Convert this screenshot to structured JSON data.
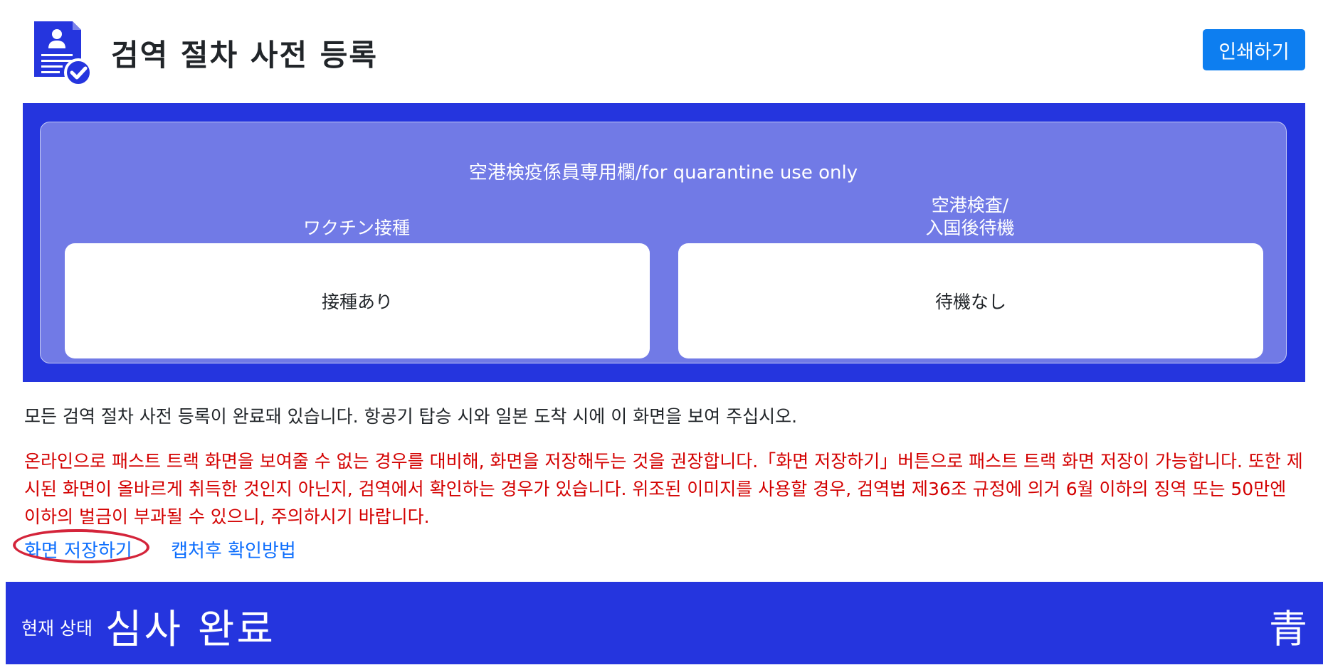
{
  "header": {
    "icon": "document-check-icon",
    "title": "검역 절차 사전 등록",
    "print_label": "인쇄하기",
    "accent_color": "#0d7ef0"
  },
  "quarantine": {
    "heading": "空港検疫係員専用欄/for quarantine use only",
    "columns": [
      {
        "label": "ワクチン接種",
        "value": "接種あり"
      },
      {
        "label_line1": "空港検査/",
        "label_line2": "入国後待機",
        "value": "待機なし"
      }
    ],
    "panel_color": "#2535de",
    "inner_color": "#717ae6"
  },
  "notices": {
    "completion": "모든 검역 절차 사전 등록이 완료돼 있습니다. 항공기 탑승 시와 일본 도착 시에 이 화면을 보여 주십시오.",
    "warning": "온라인으로 패스트 트랙 화면을 보여줄 수 없는 경우를 대비해, 화면을 저장해두는 것을 권장합니다.「화면 저장하기」버튼으로 패스트 트랙 화면 저장이 가능합니다. 또한 제시된 화면이 올바르게 취득한 것인지 아닌지, 검역에서 확인하는 경우가 있습니다. 위조된 이미지를 사용할 경우, 검역법 제36조 규정에 의거 6월 이하의 징역 또는 50만엔 이하의 벌금이 부과될 수 있으니, 주의하시기 바랍니다.",
    "warning_color": "#d30000"
  },
  "links": {
    "save_screen": "화면 저장하기",
    "capture_help": "캡처후 확인방법"
  },
  "status": {
    "label": "현재 상태",
    "value": "심사 완료",
    "color_text": "青",
    "bar_color": "#2535de"
  }
}
